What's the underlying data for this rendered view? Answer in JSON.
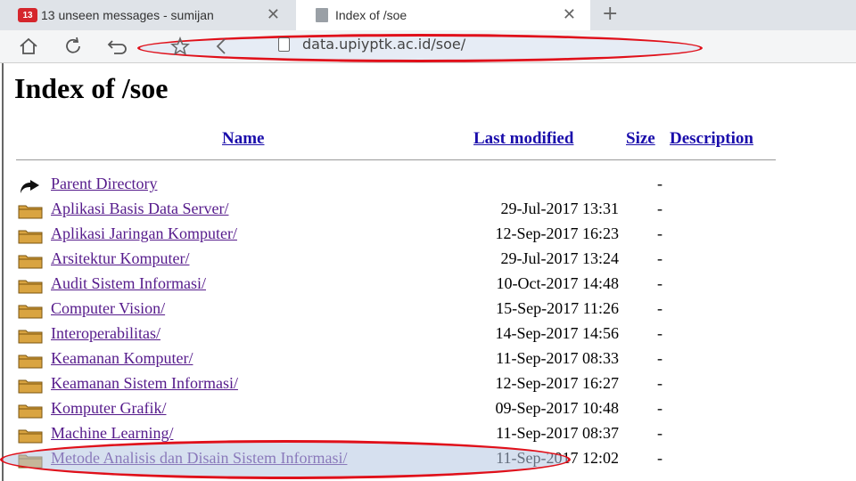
{
  "tabs": [
    {
      "badge": "13",
      "title": "13 unseen messages - sumijan",
      "close": "✕"
    },
    {
      "title": "Index of /soe",
      "close": "✕"
    }
  ],
  "new_tab": "+",
  "address_bar": {
    "url": "data.upiyptk.ac.id/soe/"
  },
  "colors": {
    "highlight_border": "#e0101a",
    "link": "#1a0dab",
    "visited": "#551a8b"
  },
  "page": {
    "title": "Index of /soe",
    "columns": {
      "name": "Name",
      "last_modified": "Last modified",
      "size": "Size",
      "description": "Description"
    },
    "rows": [
      {
        "icon": "back-icon",
        "name": "Parent Directory",
        "date": "",
        "size": "-"
      },
      {
        "icon": "folder-icon",
        "name": "Aplikasi Basis Data Server/",
        "date": "29-Jul-2017 13:31",
        "size": "-"
      },
      {
        "icon": "folder-icon",
        "name": "Aplikasi Jaringan Komputer/",
        "date": "12-Sep-2017 16:23",
        "size": "-"
      },
      {
        "icon": "folder-icon",
        "name": "Arsitektur Komputer/",
        "date": "29-Jul-2017 13:24",
        "size": "-"
      },
      {
        "icon": "folder-icon",
        "name": "Audit Sistem Informasi/",
        "date": "10-Oct-2017 14:48",
        "size": "-"
      },
      {
        "icon": "folder-icon",
        "name": "Computer Vision/",
        "date": "15-Sep-2017 11:26",
        "size": "-"
      },
      {
        "icon": "folder-icon",
        "name": "Interoperabilitas/",
        "date": "14-Sep-2017 14:56",
        "size": "-"
      },
      {
        "icon": "folder-icon",
        "name": "Keamanan Komputer/",
        "date": "11-Sep-2017 08:33",
        "size": "-"
      },
      {
        "icon": "folder-icon",
        "name": "Keamanan Sistem Informasi/",
        "date": "12-Sep-2017 16:27",
        "size": "-"
      },
      {
        "icon": "folder-icon",
        "name": "Komputer Grafik/",
        "date": "09-Sep-2017 10:48",
        "size": "-"
      },
      {
        "icon": "folder-icon",
        "name": "Machine Learning/",
        "date": "11-Sep-2017 08:37",
        "size": "-"
      },
      {
        "icon": "folder-icon",
        "name": "Metode Analisis dan Disain Sistem Informasi/",
        "date": "11-Sep-2017 12:02",
        "size": "-"
      }
    ]
  }
}
